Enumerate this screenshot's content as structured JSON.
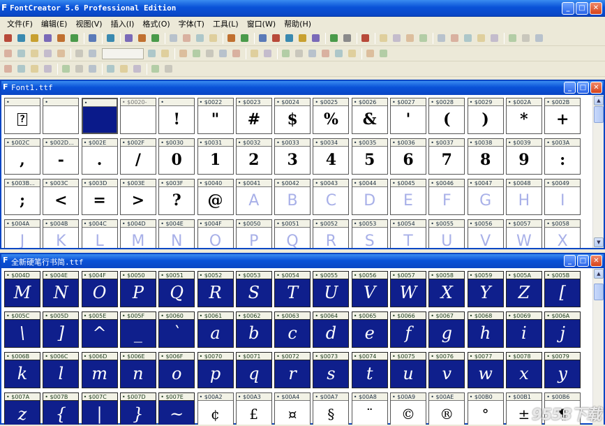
{
  "app": {
    "title": "FontCreator 5.6 Professional Edition"
  },
  "menu": [
    "文件(F)",
    "编辑(E)",
    "视图(V)",
    "插入(I)",
    "格式(O)",
    "字体(T)",
    "工具(L)",
    "窗口(W)",
    "帮助(H)"
  ],
  "window1": {
    "title": "Font1.ttf",
    "cells": [
      {
        "code": "",
        "glyph": "?",
        "state": "box"
      },
      {
        "code": "",
        "glyph": "",
        "state": "normal"
      },
      {
        "code": "",
        "glyph": "",
        "state": "selected"
      },
      {
        "code": "$0020-",
        "glyph": "",
        "state": "out"
      },
      {
        "code": "",
        "glyph": "!",
        "state": "normal"
      },
      {
        "code": "$0022",
        "glyph": "\"",
        "state": "normal"
      },
      {
        "code": "$0023",
        "glyph": "#",
        "state": "normal"
      },
      {
        "code": "$0024",
        "glyph": "$",
        "state": "normal"
      },
      {
        "code": "$0025",
        "glyph": "%",
        "state": "normal"
      },
      {
        "code": "$0026",
        "glyph": "&",
        "state": "normal"
      },
      {
        "code": "$0027",
        "glyph": "'",
        "state": "normal"
      },
      {
        "code": "$0028",
        "glyph": "(",
        "state": "normal"
      },
      {
        "code": "$0029",
        "glyph": ")",
        "state": "normal"
      },
      {
        "code": "$002A",
        "glyph": "*",
        "state": "normal"
      },
      {
        "code": "$002B",
        "glyph": "+",
        "state": "normal"
      },
      {
        "code": "$002C",
        "glyph": ",",
        "state": "normal"
      },
      {
        "code": "$002D...",
        "glyph": "-",
        "state": "normal"
      },
      {
        "code": "$002E",
        "glyph": ".",
        "state": "normal"
      },
      {
        "code": "$002F",
        "glyph": "/",
        "state": "normal"
      },
      {
        "code": "$0030",
        "glyph": "0",
        "state": "normal"
      },
      {
        "code": "$0031",
        "glyph": "1",
        "state": "normal"
      },
      {
        "code": "$0032",
        "glyph": "2",
        "state": "normal"
      },
      {
        "code": "$0033",
        "glyph": "3",
        "state": "normal"
      },
      {
        "code": "$0034",
        "glyph": "4",
        "state": "normal"
      },
      {
        "code": "$0035",
        "glyph": "5",
        "state": "normal"
      },
      {
        "code": "$0036",
        "glyph": "6",
        "state": "normal"
      },
      {
        "code": "$0037",
        "glyph": "7",
        "state": "normal"
      },
      {
        "code": "$0038",
        "glyph": "8",
        "state": "normal"
      },
      {
        "code": "$0039",
        "glyph": "9",
        "state": "normal"
      },
      {
        "code": "$003A",
        "glyph": ":",
        "state": "normal"
      },
      {
        "code": "$003B...",
        "glyph": ";",
        "state": "normal"
      },
      {
        "code": "$003C",
        "glyph": "<",
        "state": "normal"
      },
      {
        "code": "$003D",
        "glyph": "=",
        "state": "normal"
      },
      {
        "code": "$003E",
        "glyph": ">",
        "state": "normal"
      },
      {
        "code": "$003F",
        "glyph": "?",
        "state": "normal"
      },
      {
        "code": "$0040",
        "glyph": "@",
        "state": "normal"
      },
      {
        "code": "$0041",
        "glyph": "A",
        "state": "empty"
      },
      {
        "code": "$0042",
        "glyph": "B",
        "state": "empty"
      },
      {
        "code": "$0043",
        "glyph": "C",
        "state": "empty"
      },
      {
        "code": "$0044",
        "glyph": "D",
        "state": "empty"
      },
      {
        "code": "$0045",
        "glyph": "E",
        "state": "empty"
      },
      {
        "code": "$0046",
        "glyph": "F",
        "state": "empty"
      },
      {
        "code": "$0047",
        "glyph": "G",
        "state": "empty"
      },
      {
        "code": "$0048",
        "glyph": "H",
        "state": "empty"
      },
      {
        "code": "$0049",
        "glyph": "I",
        "state": "empty"
      },
      {
        "code": "$004A",
        "glyph": "J",
        "state": "empty"
      },
      {
        "code": "$004B",
        "glyph": "K",
        "state": "empty"
      },
      {
        "code": "$004C",
        "glyph": "L",
        "state": "empty"
      },
      {
        "code": "$004D",
        "glyph": "M",
        "state": "empty"
      },
      {
        "code": "$004E",
        "glyph": "N",
        "state": "empty"
      },
      {
        "code": "$004F",
        "glyph": "O",
        "state": "empty"
      },
      {
        "code": "$0050",
        "glyph": "P",
        "state": "empty"
      },
      {
        "code": "$0051",
        "glyph": "Q",
        "state": "empty"
      },
      {
        "code": "$0052",
        "glyph": "R",
        "state": "empty"
      },
      {
        "code": "$0053",
        "glyph": "S",
        "state": "empty"
      },
      {
        "code": "$0054",
        "glyph": "T",
        "state": "empty"
      },
      {
        "code": "$0055",
        "glyph": "U",
        "state": "empty"
      },
      {
        "code": "$0056",
        "glyph": "V",
        "state": "empty"
      },
      {
        "code": "$0057",
        "glyph": "W",
        "state": "empty"
      },
      {
        "code": "$0058",
        "glyph": "X",
        "state": "empty"
      }
    ]
  },
  "window2": {
    "title": "全新硬笔行书简.ttf",
    "cells": [
      {
        "code": "$004D",
        "glyph": "M",
        "state": "dark"
      },
      {
        "code": "$004E",
        "glyph": "N",
        "state": "dark"
      },
      {
        "code": "$004F",
        "glyph": "O",
        "state": "dark"
      },
      {
        "code": "$0050",
        "glyph": "P",
        "state": "dark"
      },
      {
        "code": "$0051",
        "glyph": "Q",
        "state": "dark"
      },
      {
        "code": "$0052",
        "glyph": "R",
        "state": "dark"
      },
      {
        "code": "$0053",
        "glyph": "S",
        "state": "dark"
      },
      {
        "code": "$0054",
        "glyph": "T",
        "state": "dark"
      },
      {
        "code": "$0055",
        "glyph": "U",
        "state": "dark"
      },
      {
        "code": "$0056",
        "glyph": "V",
        "state": "dark"
      },
      {
        "code": "$0057",
        "glyph": "W",
        "state": "dark"
      },
      {
        "code": "$0058",
        "glyph": "X",
        "state": "dark"
      },
      {
        "code": "$0059",
        "glyph": "Y",
        "state": "dark"
      },
      {
        "code": "$005A",
        "glyph": "Z",
        "state": "dark"
      },
      {
        "code": "$005B",
        "glyph": "[",
        "state": "dark"
      },
      {
        "code": "$005C",
        "glyph": "\\",
        "state": "dark"
      },
      {
        "code": "$005D",
        "glyph": "]",
        "state": "dark"
      },
      {
        "code": "$005E",
        "glyph": "^",
        "state": "dark"
      },
      {
        "code": "$005F",
        "glyph": "_",
        "state": "dark"
      },
      {
        "code": "$0060",
        "glyph": "`",
        "state": "dark"
      },
      {
        "code": "$0061",
        "glyph": "a",
        "state": "dark"
      },
      {
        "code": "$0062",
        "glyph": "b",
        "state": "dark"
      },
      {
        "code": "$0063",
        "glyph": "c",
        "state": "dark"
      },
      {
        "code": "$0064",
        "glyph": "d",
        "state": "dark"
      },
      {
        "code": "$0065",
        "glyph": "e",
        "state": "dark"
      },
      {
        "code": "$0066",
        "glyph": "f",
        "state": "dark"
      },
      {
        "code": "$0067",
        "glyph": "g",
        "state": "dark"
      },
      {
        "code": "$0068",
        "glyph": "h",
        "state": "dark"
      },
      {
        "code": "$0069",
        "glyph": "i",
        "state": "dark"
      },
      {
        "code": "$006A",
        "glyph": "j",
        "state": "dark"
      },
      {
        "code": "$006B",
        "glyph": "k",
        "state": "dark"
      },
      {
        "code": "$006C",
        "glyph": "l",
        "state": "dark"
      },
      {
        "code": "$006D",
        "glyph": "m",
        "state": "dark"
      },
      {
        "code": "$006E",
        "glyph": "n",
        "state": "dark"
      },
      {
        "code": "$006F",
        "glyph": "o",
        "state": "dark"
      },
      {
        "code": "$0070",
        "glyph": "p",
        "state": "dark"
      },
      {
        "code": "$0071",
        "glyph": "q",
        "state": "dark"
      },
      {
        "code": "$0072",
        "glyph": "r",
        "state": "dark"
      },
      {
        "code": "$0073",
        "glyph": "s",
        "state": "dark"
      },
      {
        "code": "$0074",
        "glyph": "t",
        "state": "dark"
      },
      {
        "code": "$0075",
        "glyph": "u",
        "state": "dark"
      },
      {
        "code": "$0076",
        "glyph": "v",
        "state": "dark"
      },
      {
        "code": "$0077",
        "glyph": "w",
        "state": "dark"
      },
      {
        "code": "$0078",
        "glyph": "x",
        "state": "dark"
      },
      {
        "code": "$0079",
        "glyph": "y",
        "state": "dark"
      },
      {
        "code": "$007A",
        "glyph": "z",
        "state": "dark"
      },
      {
        "code": "$007B",
        "glyph": "{",
        "state": "dark"
      },
      {
        "code": "$007C",
        "glyph": "|",
        "state": "dark"
      },
      {
        "code": "$007D",
        "glyph": "}",
        "state": "dark"
      },
      {
        "code": "$007E",
        "glyph": "~",
        "state": "dark"
      },
      {
        "code": "$00A2",
        "glyph": "¢",
        "state": "white"
      },
      {
        "code": "$00A3",
        "glyph": "£",
        "state": "white"
      },
      {
        "code": "$00A4",
        "glyph": "¤",
        "state": "white"
      },
      {
        "code": "$00A7",
        "glyph": "§",
        "state": "white"
      },
      {
        "code": "$00A8",
        "glyph": "¨",
        "state": "white"
      },
      {
        "code": "$00A9",
        "glyph": "©",
        "state": "white"
      },
      {
        "code": "$00AE",
        "glyph": "®",
        "state": "white"
      },
      {
        "code": "$00B0",
        "glyph": "°",
        "state": "white"
      },
      {
        "code": "$00B1",
        "glyph": "±",
        "state": "white"
      },
      {
        "code": "$00B6",
        "glyph": "¶",
        "state": "white"
      }
    ]
  },
  "watermark": "9553下载",
  "colors": {
    "titlebar": "#0a52d8",
    "selected": "#0a1a8a",
    "dark_cell": "#0f1f8c",
    "empty_glyph": "#a8b0e8"
  }
}
